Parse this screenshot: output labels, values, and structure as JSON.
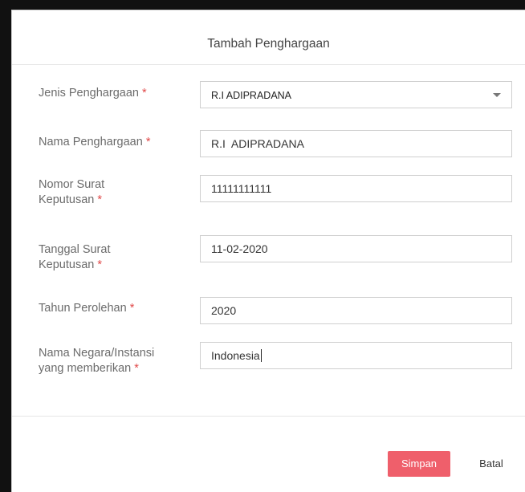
{
  "dialog": {
    "title": "Tambah Penghargaan"
  },
  "form": {
    "jenis": {
      "label": "Jenis Penghargaan",
      "required": "*",
      "value": "R.I ADIPRADANA"
    },
    "nama": {
      "label": "Nama Penghargaan",
      "required": "*",
      "value": "R.I  ADIPRADANA"
    },
    "nomor": {
      "label_line1": "Nomor Surat",
      "label_line2": "Keputusan",
      "required": "*",
      "value": "11111111111"
    },
    "tanggal": {
      "label_line1": "Tanggal Surat",
      "label_line2": "Keputusan",
      "required": "*",
      "value": "11-02-2020"
    },
    "tahun": {
      "label": "Tahun Perolehan",
      "required": "*",
      "value": "2020"
    },
    "negara": {
      "label_line1": "Nama Negara/Instansi",
      "label_line2": "yang memberikan",
      "required": "*",
      "value": "Indonesia"
    }
  },
  "footer": {
    "save_label": "Simpan",
    "cancel_label": "Batal"
  },
  "colors": {
    "accent": "#ef5f6b",
    "required": "#e04848"
  }
}
